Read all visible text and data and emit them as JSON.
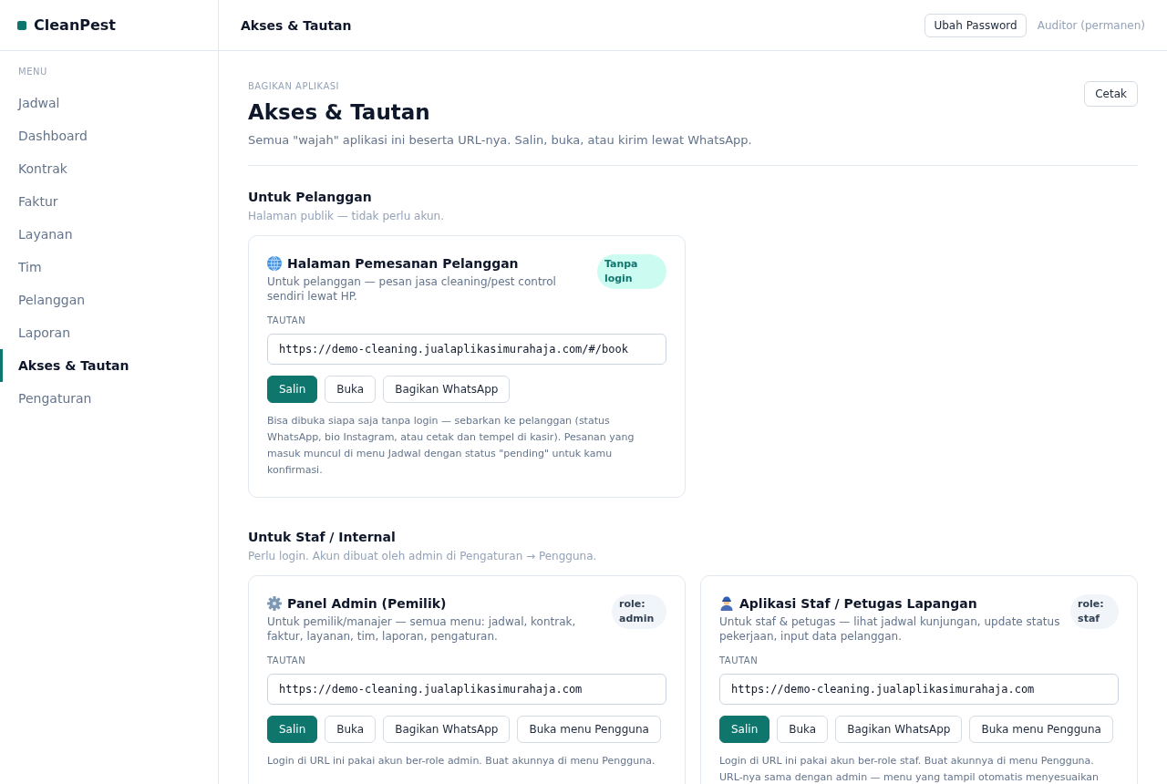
{
  "sidebar": {
    "brand": "CleanPest",
    "menu_label": "MENU",
    "items": [
      {
        "label": "Jadwal",
        "selected": false
      },
      {
        "label": "Dashboard",
        "selected": false
      },
      {
        "label": "Kontrak",
        "selected": false
      },
      {
        "label": "Faktur",
        "selected": false
      },
      {
        "label": "Layanan",
        "selected": false
      },
      {
        "label": "Tim",
        "selected": false
      },
      {
        "label": "Pelanggan",
        "selected": false
      },
      {
        "label": "Laporan",
        "selected": false
      },
      {
        "label": "Akses & Tautan",
        "selected": true
      },
      {
        "label": "Pengaturan",
        "selected": false
      }
    ]
  },
  "topbar": {
    "title": "Akses & Tautan",
    "button": "Ubah Password",
    "user": "Auditor (permanen)"
  },
  "page": {
    "eyebrow": "BAGIKAN APLIKASI",
    "title": "Akses & Tautan",
    "subtitle": "Semua \"wajah\" aplikasi ini beserta URL-nya. Salin, buka, atau kirim lewat WhatsApp.",
    "print_button": "Cetak"
  },
  "sections": [
    {
      "title": "Untuk Pelanggan",
      "subtitle": "Halaman publik — tidak perlu akun.",
      "cards": [
        {
          "kind": "public",
          "title": "Halaman Pemesanan Pelanggan",
          "description": "Untuk pelanggan — pesan jasa cleaning/pest control sendiri lewat HP.",
          "badge": "Tanpa login",
          "link_label": "TAUTAN",
          "url": "https://demo-cleaning.jualaplikasimurahaja.com/#/book",
          "actions": [
            {
              "label": "Salin",
              "kind": "copy"
            },
            {
              "label": "Buka",
              "kind": "open"
            },
            {
              "label": "Bagikan WhatsApp",
              "kind": "share"
            }
          ],
          "note": "Bisa dibuka siapa saja tanpa login — sebarkan ke pelanggan (status WhatsApp, bio Instagram, atau cetak dan tempel di kasir). Pesanan yang masuk muncul di menu Jadwal dengan status \"pending\" untuk kamu konfirmasi."
        }
      ]
    },
    {
      "title": "Untuk Staf / Internal",
      "subtitle": "Perlu login. Akun dibuat oleh admin di Pengaturan → Pengguna.",
      "cards": [
        {
          "kind": "admin",
          "title": "Panel Admin (Pemilik)",
          "description": "Untuk pemilik/manajer — semua menu: jadwal, kontrak, faktur, layanan, tim, laporan, pengaturan.",
          "badge": "role: admin",
          "link_label": "TAUTAN",
          "url": "https://demo-cleaning.jualaplikasimurahaja.com",
          "actions": [
            {
              "label": "Salin",
              "kind": "copy"
            },
            {
              "label": "Buka",
              "kind": "open"
            },
            {
              "label": "Bagikan WhatsApp",
              "kind": "share"
            },
            {
              "label": "Buka menu Pengguna",
              "kind": "users"
            }
          ],
          "note": "Login di URL ini pakai akun ber-role admin. Buat akunnya di menu Pengguna."
        },
        {
          "kind": "staff",
          "title": "Aplikasi Staf / Petugas Lapangan",
          "description": "Untuk staf & petugas — lihat jadwal kunjungan, update status pekerjaan, input data pelanggan.",
          "badge": "role: staf",
          "link_label": "TAUTAN",
          "url": "https://demo-cleaning.jualaplikasimurahaja.com",
          "actions": [
            {
              "label": "Salin",
              "kind": "copy"
            },
            {
              "label": "Buka",
              "kind": "open"
            },
            {
              "label": "Bagikan WhatsApp",
              "kind": "share"
            },
            {
              "label": "Buka menu Pengguna",
              "kind": "users"
            }
          ],
          "note": "Login di URL ini pakai akun ber-role staf. Buat akunnya di menu Pengguna. URL-nya sama dengan admin — menu yang tampil otomatis menyesuaikan"
        }
      ]
    }
  ]
}
